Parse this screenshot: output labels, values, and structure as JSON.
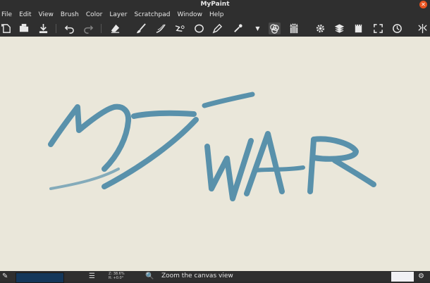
{
  "window": {
    "title": "MyPaint"
  },
  "menu": [
    "File",
    "Edit",
    "View",
    "Brush",
    "Color",
    "Layer",
    "Scratchpad",
    "Window",
    "Help"
  ],
  "toolbar_icons": [
    "new-document-icon",
    "open-folder-icon",
    "save-download-icon",
    "undo-icon",
    "redo-icon",
    "eraser-icon",
    "brush-icon",
    "curve-icon",
    "connected-lines-icon",
    "ellipse-icon",
    "pen-inking-icon",
    "color-picker-icon",
    "dropdown-arrow-icon",
    "color-palette-icon",
    "brush-set-icon",
    "settings-gear-icon",
    "layers-icon",
    "scratchpad-icon",
    "fullscreen-icon",
    "history-clock-icon",
    "symmetry-icon"
  ],
  "canvas": {
    "stroke_color": "#4d8aa8",
    "background_color": "#eae7da"
  },
  "status": {
    "current_color": "#14375a",
    "zoom_line1": "Z: 38.6%",
    "zoom_line2": "R: +0.0°",
    "message": "Zoom the canvas view"
  }
}
